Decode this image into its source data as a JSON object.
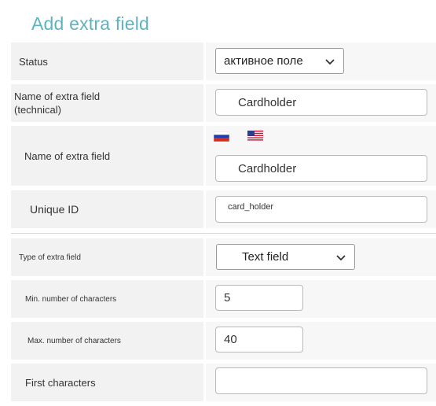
{
  "page": {
    "title": "Add extra field"
  },
  "fields": {
    "status": {
      "label": "Status",
      "value": "активное поле"
    },
    "technical_name": {
      "label": "Name of extra field (technical)",
      "value": "Cardholder"
    },
    "name": {
      "label": "Name of extra field",
      "value": "Cardholder",
      "flags": [
        "russian-flag-icon",
        "us-flag-icon"
      ]
    },
    "unique_id": {
      "label": "Unique ID",
      "value": "card_holder"
    },
    "type": {
      "label": "Type of extra field",
      "value": "Text field"
    },
    "min_chars": {
      "label": "Min. number of characters",
      "value": "5"
    },
    "max_chars": {
      "label": "Max. number of characters",
      "value": "40"
    },
    "first_chars": {
      "label": "First characters",
      "value": ""
    }
  },
  "colors": {
    "title": "#5fb3c1",
    "label_bg": "#f2f2f2",
    "value_bg": "#f7f7f7"
  }
}
